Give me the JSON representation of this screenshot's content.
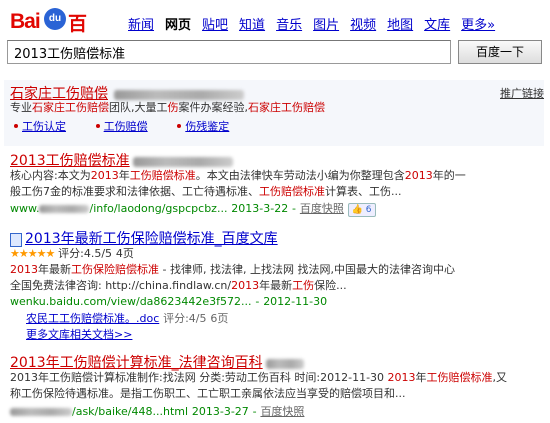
{
  "logo": {
    "text_bai": "Bai",
    "text_du": "du",
    "text_cn": "百度"
  },
  "nav": [
    "新闻",
    "网页",
    "贴吧",
    "知道",
    "音乐",
    "图片",
    "视频",
    "地图",
    "文库",
    "更多»"
  ],
  "nav_active": "网页",
  "search": {
    "query": "2013工伤赔偿标准",
    "button": "百度一下"
  },
  "ad": {
    "title": "石家庄工伤赔偿",
    "promo_label": "推广链接",
    "desc": [
      "专业",
      "石家庄工伤赔偿",
      "团队,大量工",
      "伤",
      "案件办案经验,",
      "石家庄工伤赔偿"
    ],
    "sublinks": [
      "工伤认定",
      "工伤赔偿",
      "伤残鉴定"
    ]
  },
  "results": [
    {
      "title": "2013工伤赔偿标准",
      "desc1": [
        "核心内容:本文为",
        "2013",
        "年",
        "工伤赔偿标准",
        "。本文由法律快车劳动法小编为你整理包含",
        "2013",
        "年的一"
      ],
      "desc2": [
        "般工伤7金的标准要求和法律依据、工亡待遇标准、",
        "工伤赔偿标准",
        "计算表、工伤..."
      ],
      "url": "/info/laodong/gspcpcbz...",
      "date": "2013-3-22",
      "snapshot": "百度快照",
      "like": "6"
    },
    {
      "title": "2013年最新工伤保险赔偿标准_百度文库",
      "rating": "评分:4.5/5",
      "pages": "4页",
      "desc1": [
        "2013",
        "年最新",
        "工伤保险赔偿标准",
        " - 找律师, 找法律, 上找法网 找法网,中国最大的法律咨询中心"
      ],
      "desc2": [
        "全国免费法律咨询: http://china.findlaw.cn/",
        "2013",
        "年最新",
        "工伤",
        "保险..."
      ],
      "url": "wenku.baidu.com/view/da8623442e3f572...",
      "date": "2012-11-30",
      "sub_title": "农民工工伤赔偿标准。.doc",
      "sub_rating": "评分:4/5",
      "sub_pages": "6页",
      "more": "更多文库相关文档>>"
    },
    {
      "title": "2013年工伤赔偿计算标准_法律咨询百科",
      "desc1": [
        "2013年工伤赔偿计算标准制作:找法网 分类:劳动工伤百科  时间:2012-11-30 ",
        "2013",
        "年",
        "工伤赔偿标准",
        ",又"
      ],
      "desc2": [
        "称工伤保险待遇标准。是指工伤职工、工亡职工亲属依法应当享受的赔偿项目和..."
      ],
      "url": "/ask/baike/448...html",
      "date": "2013-3-27",
      "snapshot": "百度快照"
    }
  ]
}
